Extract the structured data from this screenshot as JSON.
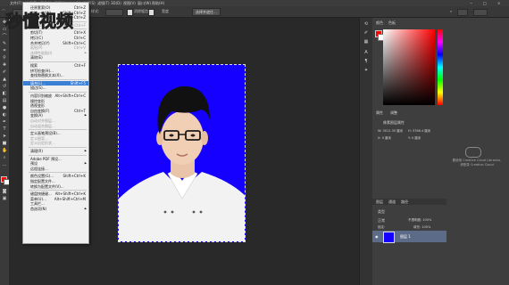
{
  "menubar": {
    "items": [
      "文件(F)",
      "编辑(E)",
      "图像(I)",
      "图层(L)",
      "文字(Y)",
      "选择(S)",
      "滤镜(T)",
      "3D(D)",
      "视图(V)",
      "窗口(W)",
      "帮助(H)"
    ]
  },
  "options": {
    "select_subject": "选择并遮住...",
    "new_document": "新建",
    "visible_toggle": "消除锯齿",
    "style_label": "样式:",
    "width_label": "宽度",
    "height_label": "高度"
  },
  "edit_menu": {
    "items": [
      {
        "label": "还原套索(O)",
        "shortcut": "Ctrl+Z",
        "state": "normal"
      },
      {
        "label": "前进一步(W)",
        "shortcut": "Shift+Ctrl+Z",
        "state": "normal"
      },
      {
        "label": "后退一步(K)",
        "shortcut": "Alt+Ctrl+Z",
        "state": "normal"
      },
      {
        "sep": true
      },
      {
        "label": "渐隐(D)...",
        "shortcut": "Shift+Ctrl+F",
        "state": "disabled"
      },
      {
        "sep": true
      },
      {
        "label": "剪切(T)",
        "shortcut": "Ctrl+X",
        "state": "normal"
      },
      {
        "label": "拷贝(C)",
        "shortcut": "Ctrl+C",
        "state": "normal"
      },
      {
        "label": "合并拷贝(Y)",
        "shortcut": "Shift+Ctrl+C",
        "state": "normal"
      },
      {
        "label": "粘贴(P)",
        "shortcut": "Ctrl+V",
        "state": "disabled"
      },
      {
        "label": "选择性粘贴(I)",
        "shortcut": "",
        "state": "disabled",
        "sub": true
      },
      {
        "label": "清除(E)",
        "shortcut": "",
        "state": "normal"
      },
      {
        "sep": true
      },
      {
        "label": "搜索",
        "shortcut": "Ctrl+F",
        "state": "normal"
      },
      {
        "label": "拼写检查(H)...",
        "shortcut": "",
        "state": "normal"
      },
      {
        "label": "查找和替换文本(X)...",
        "shortcut": "",
        "state": "normal"
      },
      {
        "sep": true
      },
      {
        "label": "填充(L)...",
        "shortcut": "Shift+F5",
        "state": "highlight"
      },
      {
        "label": "描边(S)...",
        "shortcut": "",
        "state": "normal"
      },
      {
        "sep": true
      },
      {
        "label": "内容识别缩放",
        "shortcut": "Alt+Shift+Ctrl+C",
        "state": "normal"
      },
      {
        "label": "操控变形",
        "shortcut": "",
        "state": "normal"
      },
      {
        "label": "透视变形",
        "shortcut": "",
        "state": "normal"
      },
      {
        "label": "自由变换(F)",
        "shortcut": "Ctrl+T",
        "state": "normal"
      },
      {
        "label": "变换(A)",
        "shortcut": "",
        "state": "normal",
        "sub": true
      },
      {
        "label": "自动对齐图层...",
        "shortcut": "",
        "state": "disabled"
      },
      {
        "label": "自动混合图层...",
        "shortcut": "",
        "state": "disabled"
      },
      {
        "sep": true
      },
      {
        "label": "定义画笔预设(B)...",
        "shortcut": "",
        "state": "normal"
      },
      {
        "label": "定义图案...",
        "shortcut": "",
        "state": "disabled"
      },
      {
        "label": "定义自定形状...",
        "shortcut": "",
        "state": "disabled"
      },
      {
        "sep": true
      },
      {
        "label": "清理(R)",
        "shortcut": "",
        "state": "normal",
        "sub": true
      },
      {
        "sep": true
      },
      {
        "label": "Adobe PDF 预设...",
        "shortcut": "",
        "state": "normal"
      },
      {
        "label": "预设",
        "shortcut": "",
        "state": "normal",
        "sub": true
      },
      {
        "label": "远程连接...",
        "shortcut": "",
        "state": "normal"
      },
      {
        "sep": true
      },
      {
        "label": "颜色设置(G)...",
        "shortcut": "Shift+Ctrl+K",
        "state": "normal"
      },
      {
        "label": "指定配置文件...",
        "shortcut": "",
        "state": "normal"
      },
      {
        "label": "转换为配置文件(V)...",
        "shortcut": "",
        "state": "normal"
      },
      {
        "sep": true
      },
      {
        "label": "键盘快捷键...",
        "shortcut": "Alt+Shift+Ctrl+K",
        "state": "normal"
      },
      {
        "label": "菜单(U)...",
        "shortcut": "Alt+Shift+Ctrl+M",
        "state": "normal"
      },
      {
        "label": "工具栏...",
        "shortcut": "",
        "state": "normal"
      },
      {
        "label": "首选项(N)",
        "shortcut": "",
        "state": "normal",
        "sub": true
      }
    ]
  },
  "watermark": {
    "text": "秒懂视频"
  },
  "panels": {
    "color_tab": "颜色",
    "swatches_tab": "色板",
    "properties_tab": "属性",
    "adjust_tab": "调整",
    "properties_title": "像素图层属性",
    "w_label": "W: 3011.35 厘米",
    "h_label": "H: 3766.4 厘米",
    "x_label": "X: 0 厘米",
    "y_label": "Y: 0 厘米",
    "cc_line1": "要使用 Creative Cloud Libraries,",
    "cc_line2": "请登录 Creative Cloud",
    "layers_tab": "图层",
    "channels_tab": "通道",
    "paths_tab": "路径",
    "kind_label": "类型",
    "normal_label": "正常",
    "opacity_label": "不透明度: 100%",
    "lock_label": "锁定:",
    "fill_label": "填充: 100%",
    "layer_name": "图层 1"
  },
  "colors": {
    "photo_bg": "#1500ff",
    "highlight": "#3a7fd6",
    "fg_swatch": "#ff0000",
    "bg_swatch": "#ffffff"
  }
}
